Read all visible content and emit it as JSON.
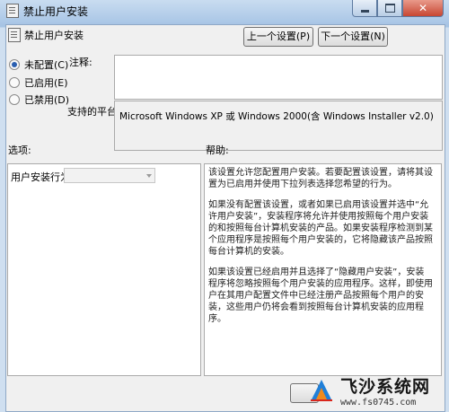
{
  "window": {
    "title": "禁止用户安装",
    "setting_name": "禁止用户安装"
  },
  "nav": {
    "prev_label": "上一个设置(P)",
    "next_label": "下一个设置(N)"
  },
  "state": {
    "options": [
      {
        "label": "未配置(C)",
        "selected": true
      },
      {
        "label": "已启用(E)",
        "selected": false
      },
      {
        "label": "已禁用(D)",
        "selected": false
      }
    ]
  },
  "comment": {
    "label": "注释:",
    "value": ""
  },
  "platform": {
    "label": "支持的平台:",
    "value": "Microsoft Windows XP 或 Windows 2000(含 Windows Installer v2.0)"
  },
  "options_section": {
    "header": "选项:",
    "behavior_label": "用户安装行为:",
    "behavior_value": ""
  },
  "help_section": {
    "header": "帮助:",
    "paragraphs": [
      "该设置允许您配置用户安装。若要配置该设置，请将其设置为已启用并使用下拉列表选择您希望的行为。",
      "如果没有配置该设置，或者如果已启用该设置并选中“允许用户安装”，安装程序将允许并使用按照每个用户安装的和按照每台计算机安装的产品。如果安装程序检测到某个应用程序是按照每个用户安装的，它将隐藏该产品按照每台计算机的安装。",
      "如果该设置已经启用并且选择了“隐藏用户安装”，安装程序将忽略按照每个用户安装的应用程序。这样，即使用户在其用户配置文件中已经注册产品按照每个用户的安装，这些用户仍将会看到按照每台计算机安装的应用程序。"
    ]
  },
  "watermark": {
    "title": "飞沙系统网",
    "url": "www.fs0745.com"
  }
}
